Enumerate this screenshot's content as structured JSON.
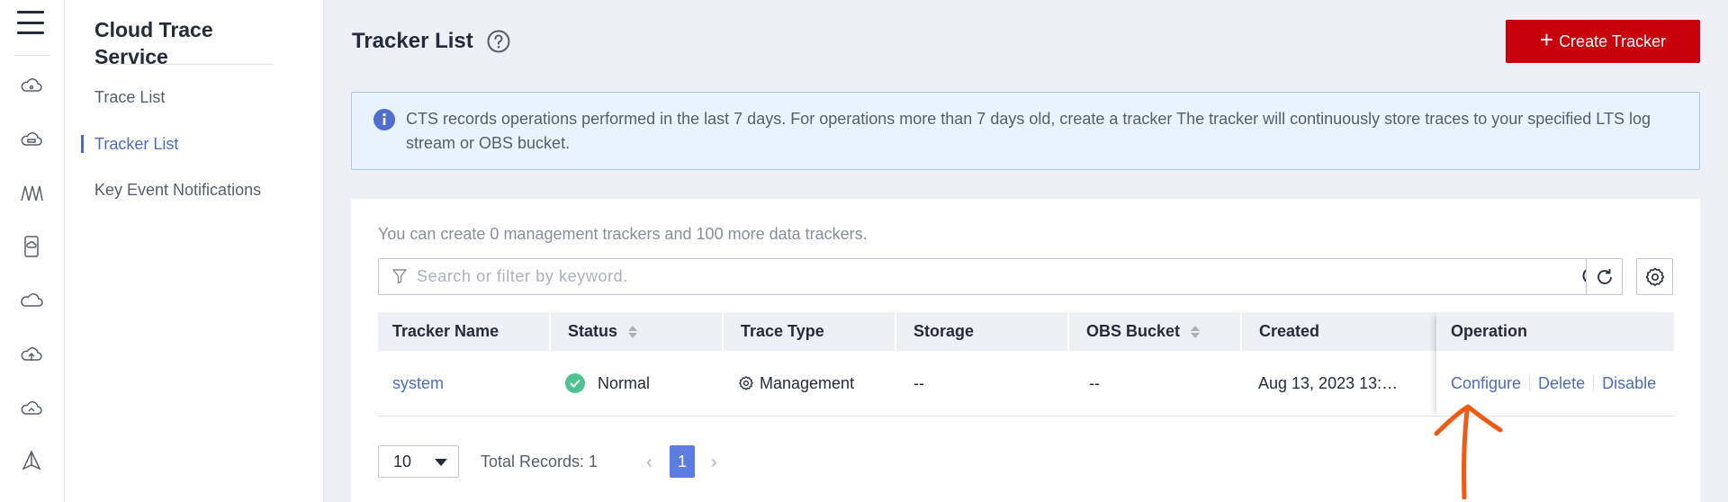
{
  "sidebar": {
    "service_title": "Cloud Trace Service",
    "items": [
      {
        "label": "Trace List",
        "active": false
      },
      {
        "label": "Tracker List",
        "active": true
      },
      {
        "label": "Key Event Notifications",
        "active": false
      }
    ]
  },
  "rail_icons": [
    "cloud-icon",
    "cloud-icon",
    "waves-icon",
    "phone-cloud-icon",
    "cloud-icon",
    "cloud-upload-icon",
    "cloud-icon",
    "triangle-icon"
  ],
  "header": {
    "title": "Tracker List",
    "create_label": "Create Tracker"
  },
  "notice": {
    "text": "CTS records operations performed in the last 7 days. For operations more than 7 days old, create a tracker The tracker will continuously store traces to your specified LTS log stream or OBS bucket."
  },
  "list": {
    "quota_text": "You can create 0 management trackers and 100 more data trackers.",
    "search_placeholder": "Search or filter by keyword.",
    "columns": [
      "Tracker Name",
      "Status",
      "Trace Type",
      "Storage",
      "OBS Bucket",
      "Created",
      "Operation"
    ],
    "rows": [
      {
        "name": "system",
        "status": "Normal",
        "trace_type": "Management",
        "storage": "--",
        "obs_bucket": "--",
        "created": "Aug 13, 2023 13:…",
        "operations": [
          "Configure",
          "Delete",
          "Disable"
        ]
      }
    ]
  },
  "pagination": {
    "page_size": "10",
    "total": "Total Records: 1",
    "current_page": "1"
  },
  "colors": {
    "brand_red": "#c7000b",
    "link_blue": "#4c6cc1",
    "status_green": "#4fc38f",
    "annotation_orange": "#f05a14"
  }
}
